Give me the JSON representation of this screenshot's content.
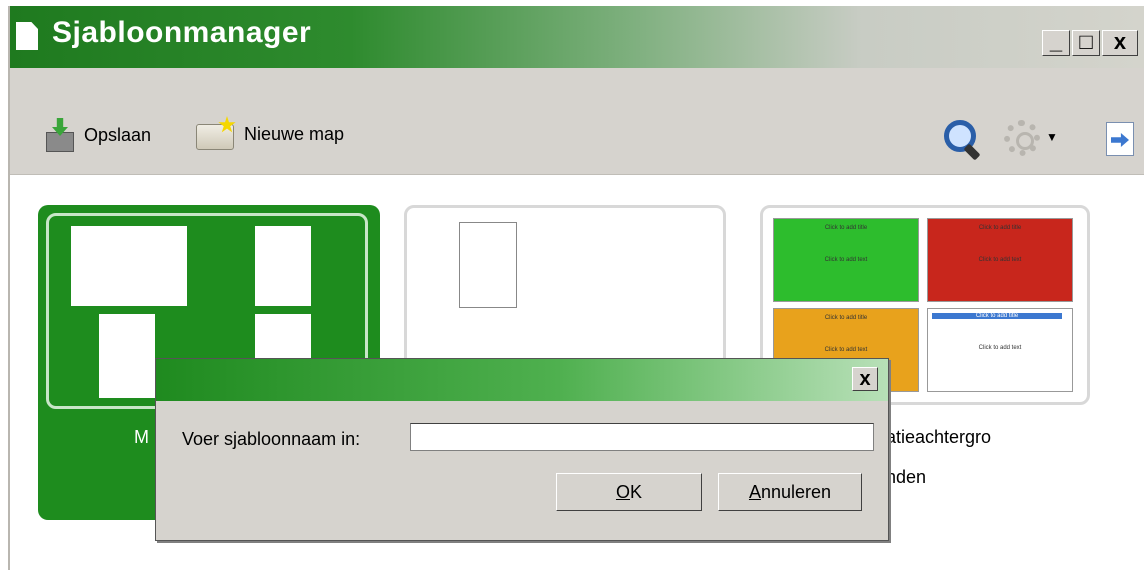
{
  "window": {
    "title": "Sjabloonmanager",
    "controls": {
      "minimize": "_",
      "maximize": "□",
      "close": "x"
    }
  },
  "toolbar": {
    "save_label": "Opslaan",
    "new_folder_label": "Nieuwe map",
    "icons": [
      "save-icon",
      "new-folder-icon",
      "search-icon",
      "gear-icon",
      "exit-icon"
    ]
  },
  "folders": [
    {
      "label": "M"
    },
    {
      "label": ""
    },
    {
      "label_line1": "atieachtergro",
      "label_line2": "nden"
    }
  ],
  "presentation_thumbs": [
    {
      "title": "Click to add title",
      "body": "Click to add text",
      "color": "#2dbd2d"
    },
    {
      "title": "Click to add title",
      "body": "Click to add text",
      "color": "#c8261c"
    },
    {
      "title": "Click to add title",
      "body": "Click to add text",
      "color": "#e8a21c"
    },
    {
      "title": "Click to add title",
      "body": "Click to add text",
      "color": "#ffffff"
    }
  ],
  "dialog": {
    "prompt": "Voer sjabloonnaam in:",
    "input_value": "",
    "ok_accel": "O",
    "ok_rest": "K",
    "cancel_accel": "A",
    "cancel_rest": "nnuleren",
    "close": "x"
  },
  "colors": {
    "accent": "#1e8c1e",
    "chrome": "#d6d3ce"
  }
}
